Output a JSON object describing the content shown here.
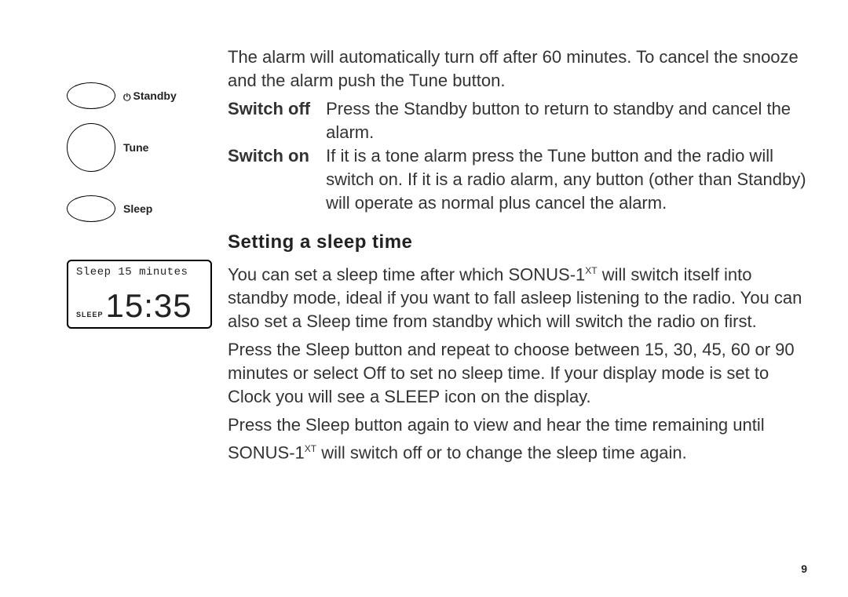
{
  "sidebar": {
    "standby": {
      "label": "Standby"
    },
    "tune": {
      "label": "Tune"
    },
    "sleep": {
      "label": "Sleep"
    },
    "lcd": {
      "line1": "Sleep 15 minutes",
      "clock_tag": "SLEEP",
      "clock": "15:35"
    }
  },
  "body": {
    "intro": "The alarm will automatically turn off after 60 minutes. To cancel the snooze and the alarm push the Tune button.",
    "switch_off": {
      "term": "Switch off",
      "desc": "Press the Standby button to return to standby and cancel the alarm."
    },
    "switch_on": {
      "term": "Switch on",
      "desc": "If it is a tone alarm press the Tune button and the radio will switch on. If it is a radio alarm, any button (other than Standby) will operate as normal plus cancel the alarm."
    },
    "heading": "Setting a sleep time",
    "p1_a": "You can set a sleep time after which SONUS-1",
    "p1_sup": "XT",
    "p1_b": " will switch itself into standby mode, ideal if you want to fall asleep listening to the radio. You can also set a Sleep time from standby which will switch the radio on first.",
    "p2": "Press the Sleep button and repeat to choose between 15, 30, 45, 60 or 90 minutes or select Off to set no sleep time. If your display mode is set to Clock you will see a SLEEP icon on the display.",
    "p3_a": "Press the Sleep button again to view and hear the time remaining until SONUS-1",
    "p3_sup": "XT",
    "p3_b": " will switch off or to change the sleep time again."
  },
  "page_number": "9"
}
